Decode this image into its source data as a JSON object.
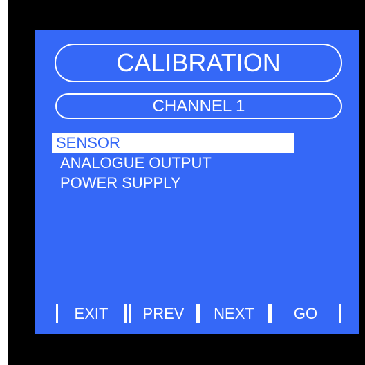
{
  "screen": {
    "title": "CALIBRATION",
    "subtitle": "CHANNEL 1"
  },
  "menu": {
    "items": [
      {
        "label": "SENSOR",
        "selected": true
      },
      {
        "label": "ANALOGUE OUTPUT",
        "selected": false
      },
      {
        "label": "POWER SUPPLY",
        "selected": false
      }
    ]
  },
  "softkeys": {
    "exit": "EXIT",
    "prev": "PREV",
    "next": "NEXT",
    "go": "GO"
  },
  "colors": {
    "screen_background": "#3568f7",
    "frame": "#000000",
    "text": "#ffffff",
    "selected_background": "#ffffff"
  }
}
